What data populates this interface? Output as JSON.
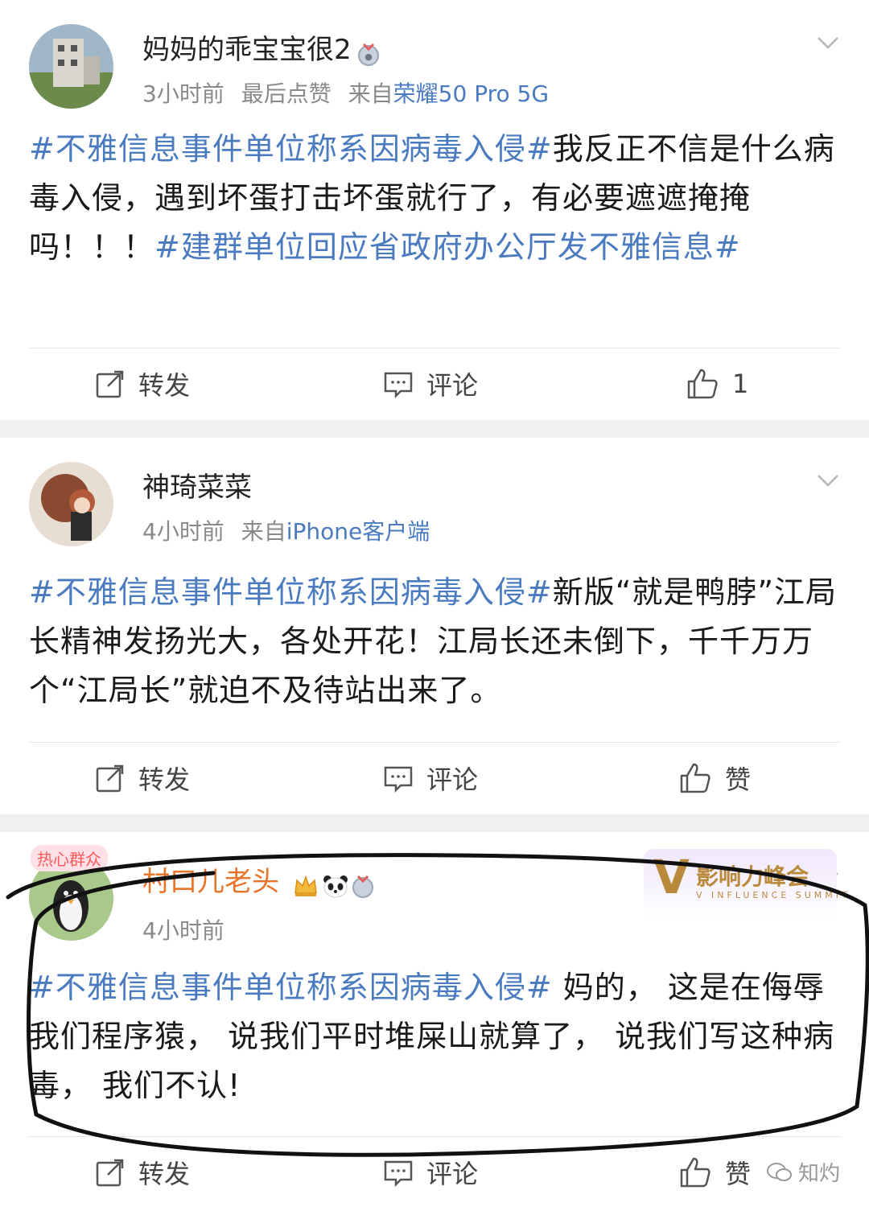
{
  "posts": [
    {
      "user": "妈妈的乖宝宝很2",
      "time": "3小时前",
      "extra": "最后点赞",
      "from_prefix": "来自",
      "source": "荣耀50 Pro 5G",
      "content": [
        {
          "type": "topic",
          "text": "#不雅信息事件单位称系因病毒入侵#"
        },
        {
          "type": "text",
          "text": "我反正不信是什么病毒入侵，遇到坏蛋打击坏蛋就行了，有必要遮遮掩掩吗！！！"
        },
        {
          "type": "topic",
          "text": "#建群单位回应省政府办公厅发不雅信息#"
        }
      ],
      "repost": "转发",
      "comment": "评论",
      "like": "1"
    },
    {
      "user": "神琦菜菜",
      "time": "4小时前",
      "from_prefix": "来自",
      "source": "iPhone客户端",
      "content": [
        {
          "type": "topic",
          "text": "#不雅信息事件单位称系因病毒入侵#"
        },
        {
          "type": "text",
          "text": "新版“就是鸭脖”江局长精神发扬光大，各处开花！江局长还未倒下，千千万万个“江局长”就迫不及待站出来了。"
        }
      ],
      "repost": "转发",
      "comment": "评论",
      "like": "赞"
    },
    {
      "user": "村口儿老头",
      "time": "4小时前",
      "content": [
        {
          "type": "topic",
          "text": "#不雅信息事件单位称系因病毒入侵#"
        },
        {
          "type": "text",
          "text": " 妈的， 这是在侮辱我们程序猿， 说我们平时堆屎山就算了， 说我们写这种病毒， 我们不认!"
        }
      ],
      "repost": "转发",
      "comment": "评论",
      "like": "赞",
      "hot_tag": "热心群众"
    }
  ],
  "summit": {
    "main": "影响力峰会",
    "sub": "V INFLUENCE SUMMIT",
    "letter": "V"
  },
  "watermark": "知灼",
  "colors": {
    "topic": "#4a7bc0",
    "orange_name": "#e8742a",
    "separator": "#efefef"
  }
}
